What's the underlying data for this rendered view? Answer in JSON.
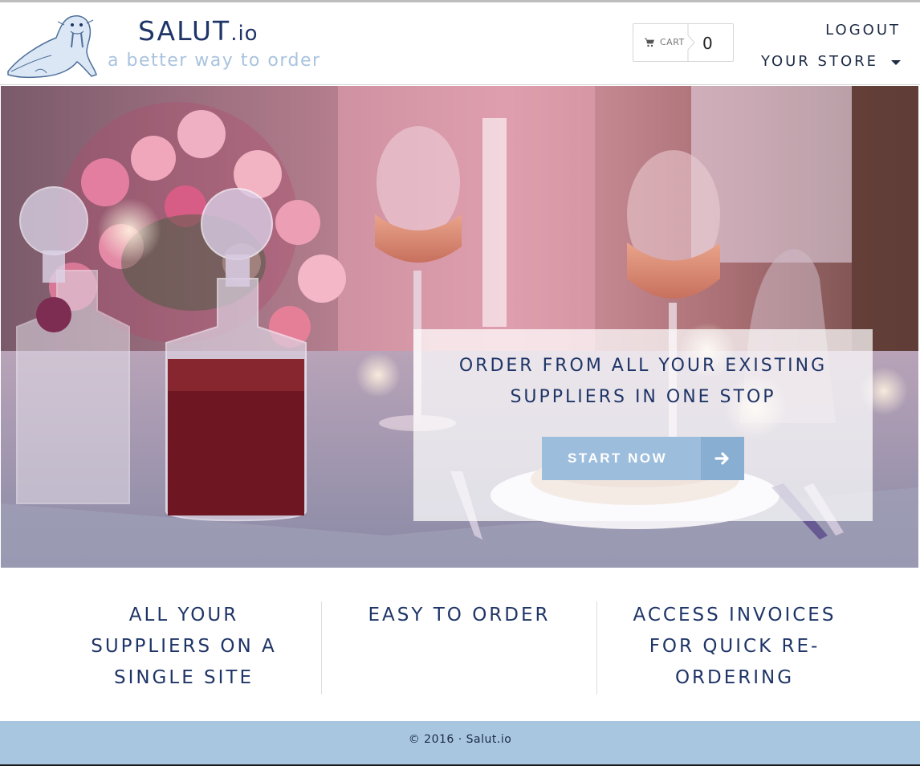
{
  "header": {
    "brand_main": "SALUT",
    "brand_suffix": ".io",
    "tagline": "a better way to order",
    "logo_icon": "walrus-logo-icon"
  },
  "cart": {
    "label": "CART",
    "count": "0",
    "icon": "shopping-cart-icon"
  },
  "nav": {
    "logout": "LOGOUT",
    "store": "YOUR STORE",
    "store_icon": "caret-down-icon"
  },
  "hero": {
    "headline_line1": "ORDER FROM ALL YOUR EXISTING",
    "headline_line2": "SUPPLIERS IN ONE STOP",
    "cta_label": "START NOW",
    "cta_icon": "arrow-right-icon"
  },
  "features": [
    {
      "line1": "ALL YOUR",
      "line2": "SUPPLIERS ON A",
      "line3": "SINGLE SITE"
    },
    {
      "line1": "EASY TO ORDER",
      "line2": "",
      "line3": ""
    },
    {
      "line1": "ACCESS INVOICES",
      "line2": "FOR QUICK RE-",
      "line3": "ORDERING"
    }
  ],
  "footer": {
    "text": "© 2016 · Salut.io"
  },
  "colors": {
    "brand_navy": "#1f3567",
    "tagline_blue": "#a9c3de",
    "button_blue": "#9dbddd",
    "footer_blue": "#a9c6e0"
  }
}
